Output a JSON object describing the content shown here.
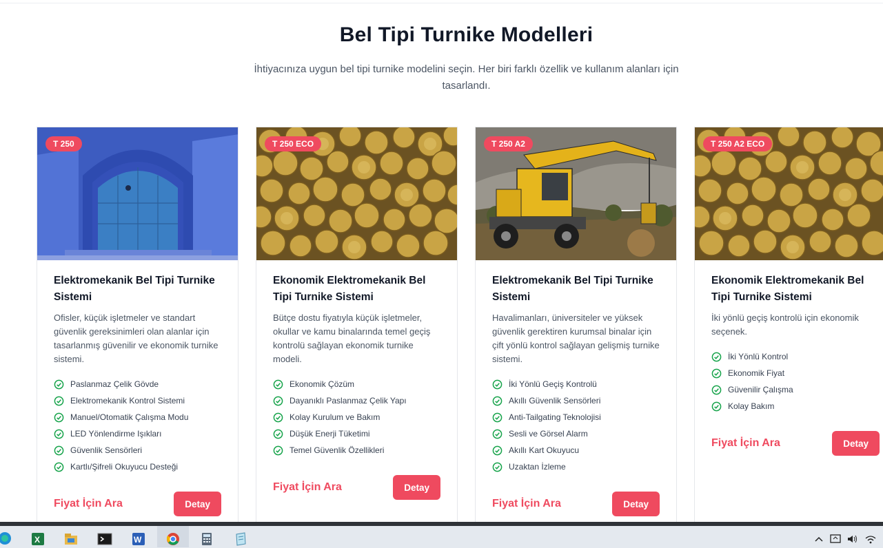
{
  "header": {
    "title": "Bel Tipi Turnike Modelleri",
    "subtitle": "İhtiyacınıza uygun bel tipi turnike modelini seçin. Her biri farklı özellik ve kullanım alanları için tasarlandı."
  },
  "colors": {
    "accent": "#ef4a5f",
    "check": "#16a34a"
  },
  "cards": [
    {
      "badge": "T 250",
      "image": "blue-door-photo",
      "title": "Elektromekanik Bel Tipi Turnike Sistemi",
      "description": "Ofisler, küçük işletmeler ve standart güvenlik gereksinimleri olan alanlar için tasarlanmış güvenilir ve ekonomik turnike sistemi.",
      "features": [
        "Paslanmaz Çelik Gövde",
        "Elektromekanik Kontrol Sistemi",
        "Manuel/Otomatik Çalışma Modu",
        "LED Yönlendirme Işıkları",
        "Güvenlik Sensörleri",
        "Kartlı/Şifreli Okuyucu Desteği"
      ],
      "price_label": "Fiyat İçin Ara",
      "button_label": "Detay"
    },
    {
      "badge": "T 250 ECO",
      "image": "coins-photo",
      "title": "Ekonomik Elektromekanik Bel Tipi Turnike Sistemi",
      "description": "Bütçe dostu fiyatıyla küçük işletmeler, okullar ve kamu binalarında temel geçiş kontrolü sağlayan ekonomik turnike modeli.",
      "features": [
        "Ekonomik Çözüm",
        "Dayanıklı Paslanmaz Çelik Yapı",
        "Kolay Kurulum ve Bakım",
        "Düşük Enerji Tüketimi",
        "Temel Güvenlik Özellikleri"
      ],
      "price_label": "Fiyat İçin Ara",
      "button_label": "Detay"
    },
    {
      "badge": "T 250 A2",
      "image": "excavator-photo",
      "title": "Elektromekanik Bel Tipi Turnike Sistemi",
      "description": "Havalimanları, üniversiteler ve yüksek güvenlik gerektiren kurumsal binalar için çift yönlü kontrol sağlayan gelişmiş turnike sistemi.",
      "features": [
        "İki Yönlü Geçiş Kontrolü",
        "Akıllı Güvenlik Sensörleri",
        "Anti-Tailgating Teknolojisi",
        "Sesli ve Görsel Alarm",
        "Akıllı Kart Okuyucu",
        "Uzaktan İzleme"
      ],
      "price_label": "Fiyat İçin Ara",
      "button_label": "Detay"
    },
    {
      "badge": "T 250 A2 ECO",
      "image": "coins-photo",
      "title": "Ekonomik Elektromekanik Bel Tipi Turnike Sistemi",
      "description": "İki yönlü geçiş kontrolü için ekonomik seçenek.",
      "features": [
        "İki Yönlü Kontrol",
        "Ekonomik Fiyat",
        "Güvenilir Çalışma",
        "Kolay Bakım"
      ],
      "price_label": "Fiyat İçin Ara",
      "button_label": "Detay"
    }
  ],
  "taskbar": {
    "apps": [
      "edge-icon",
      "excel-icon",
      "file-explorer-icon",
      "terminal-icon",
      "word-icon",
      "chrome-icon",
      "calculator-icon",
      "notepad-icon"
    ],
    "tray": [
      "chevron-up-icon",
      "network-icon",
      "volume-icon",
      "wifi-icon"
    ]
  }
}
